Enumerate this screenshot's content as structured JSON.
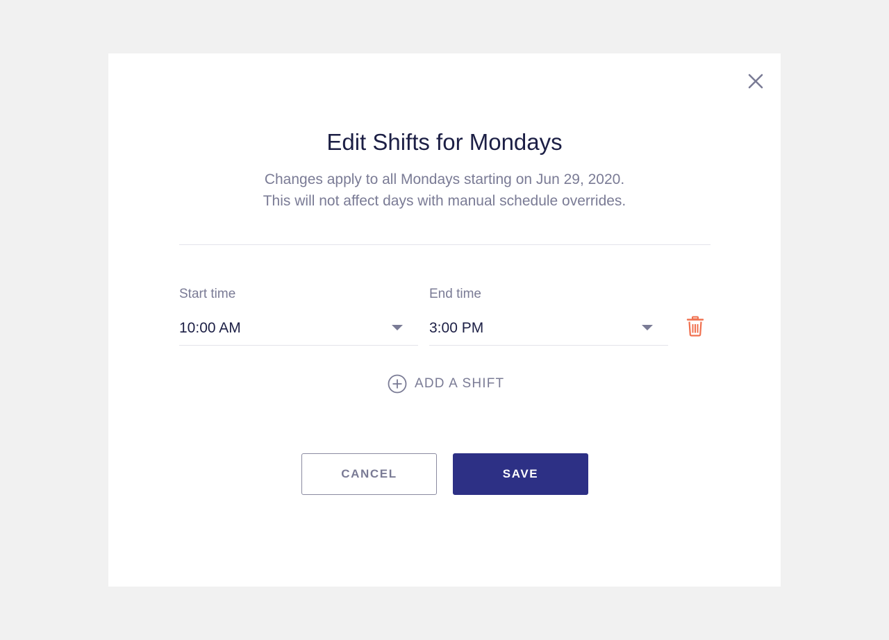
{
  "dialog": {
    "title": "Edit Shifts for Mondays",
    "subtitle_line1": "Changes apply to all Mondays starting on Jun 29, 2020.",
    "subtitle_line2": "This will not affect days with manual schedule overrides.",
    "close_icon": "close-icon"
  },
  "shift": {
    "start_label": "Start time",
    "start_value": "10:00 AM",
    "end_label": "End time",
    "end_value": "3:00 PM",
    "delete_icon": "trash-icon"
  },
  "add_shift": {
    "label": "ADD A SHIFT",
    "icon": "plus-circle-icon"
  },
  "actions": {
    "cancel_label": "CANCEL",
    "save_label": "SAVE"
  },
  "colors": {
    "background": "#f1f1f1",
    "title": "#1c1f45",
    "muted_text": "#7a7b95",
    "primary": "#2d3085",
    "danger": "#f0704f"
  }
}
